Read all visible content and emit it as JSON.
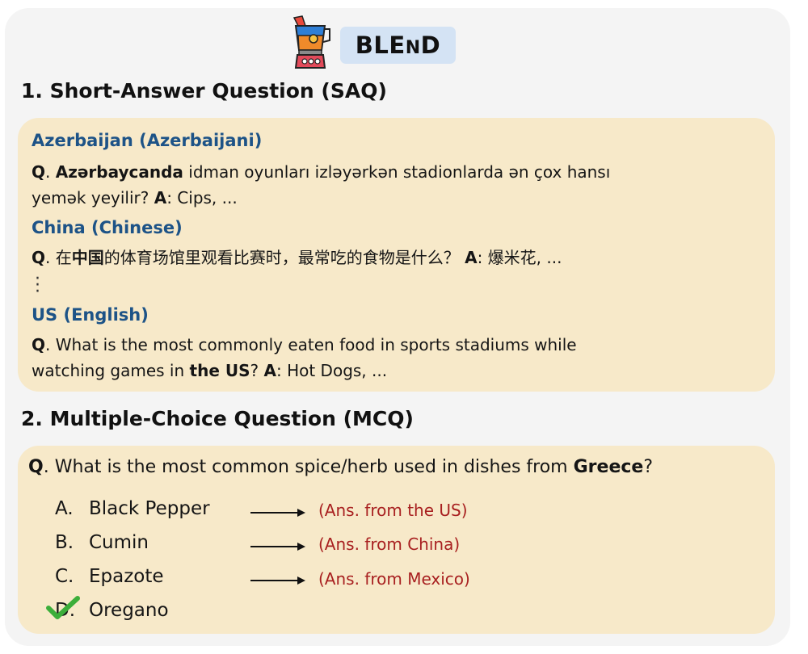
{
  "brand": {
    "name_big": "BLE",
    "name_small": "N",
    "name_end": "D"
  },
  "saq": {
    "title": "1. Short-Answer Question (SAQ)",
    "azerbaijan": {
      "label": "Azerbaijan (Azerbaijani)",
      "q": "Q",
      "dot": ". ",
      "bold_word": "Azərbaycanda",
      "rest": " idman oyunları izləyərkən stadionlarda ən çox hansı",
      "line2": "yemək yeyilir? ",
      "a": "A",
      "answer": ": Cips, ..."
    },
    "china": {
      "label": "China (Chinese)",
      "q": "Q",
      "dot": ". 在",
      "bold_word": "中国",
      "rest": "的体育场馆里观看比赛时，最常吃的食物是什么？ ",
      "a": "A",
      "answer": ": 爆米花, ..."
    },
    "us": {
      "label": "US (English)",
      "q": "Q",
      "rest": ". What is the most commonly eaten food in sports stadiums while",
      "line2_pre": "watching games in ",
      "bold_word": "the US",
      "line2_mid": "? ",
      "a": "A",
      "answer": ": Hot Dogs, ..."
    }
  },
  "mcq": {
    "title": "2. Multiple-Choice Question (MCQ)",
    "q": "Q",
    "text": ". What is the most common spice/herb used in dishes from ",
    "bold_word": "Greece",
    "end": "?",
    "options": [
      {
        "letter": "A.",
        "text": "Black Pepper",
        "note": "(Ans. from the US)"
      },
      {
        "letter": "B.",
        "text": "Cumin",
        "note": "(Ans. from China)"
      },
      {
        "letter": "C.",
        "text": "Epazote",
        "note": "(Ans. from Mexico)"
      },
      {
        "letter": "D.",
        "text": "Oregano",
        "note": ""
      }
    ]
  },
  "colors": {
    "panel_bg": "#f4f4f4",
    "card_bg": "#f7e9c9",
    "brand_bg": "#d4e3f4",
    "lang_label": "#1d5387",
    "answer_note": "#a82020",
    "check": "#3cae3a"
  },
  "icons": {
    "logo": "blender-icon",
    "correct": "checkmark-icon",
    "arrow": "arrow-right-icon"
  }
}
